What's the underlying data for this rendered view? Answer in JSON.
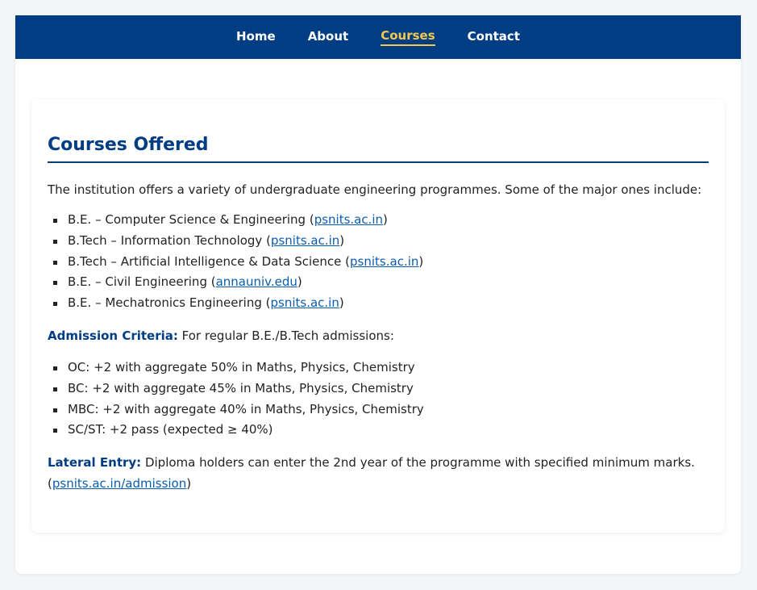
{
  "nav": {
    "items": [
      {
        "label": "Home",
        "active": false
      },
      {
        "label": "About",
        "active": false
      },
      {
        "label": "Courses",
        "active": true
      },
      {
        "label": "Contact",
        "active": false
      }
    ],
    "active_color": "#f2c94c",
    "bar_color": "#003d82"
  },
  "main": {
    "title": "Courses Offered",
    "intro": "The institution offers a variety of undergraduate engineering programmes. Some of the major ones include:",
    "courses": [
      {
        "name": "B.E. – Computer Science & Engineering",
        "source": "psnits.ac.in"
      },
      {
        "name": "B.Tech – Information Technology",
        "source": "psnits.ac.in"
      },
      {
        "name": "B.Tech – Artificial Intelligence & Data Science",
        "source": "psnits.ac.in"
      },
      {
        "name": "B.E. – Civil Engineering",
        "source": "annauniv.edu"
      },
      {
        "name": "B.E. – Mechatronics Engineering",
        "source": "psnits.ac.in"
      }
    ],
    "admission": {
      "label": "Admission Criteria:",
      "text": "For regular B.E./B.Tech admissions:",
      "criteria": [
        "OC: +2 with aggregate 50% in Maths, Physics, Chemistry",
        "BC: +2 with aggregate 45% in Maths, Physics, Chemistry",
        "MBC: +2 with aggregate 40% in Maths, Physics, Chemistry",
        "SC/ST: +2 pass (expected ≥ 40%)"
      ]
    },
    "lateral": {
      "label": "Lateral Entry:",
      "text": "Diploma holders can enter the 2nd year of the programme with specified minimum marks.",
      "source": "psnits.ac.in/admission"
    }
  }
}
